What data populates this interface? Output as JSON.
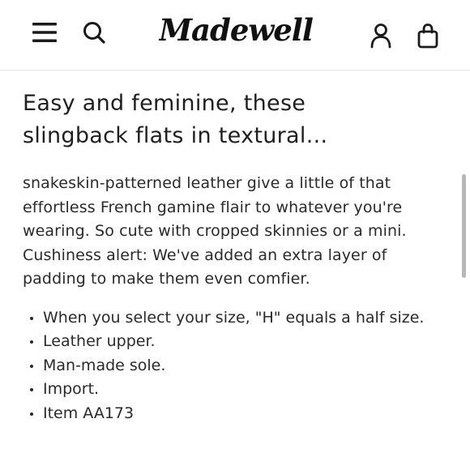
{
  "header": {
    "menu_icon": "hamburger-menu-icon",
    "search_icon": "search-icon",
    "logo_text": "Madewell",
    "account_icon": "account-person-icon",
    "bag_icon": "shopping-bag-icon"
  },
  "product": {
    "title": "Easy and feminine, these slingback flats in textural...",
    "description": "snakeskin-patterned leather give a little of that effortless French gamine flair to whatever you're wearing. So cute with cropped skinnies or a mini. Cushiness alert: We've added an extra layer of padding to make them even comfier.",
    "details": [
      "When you select your size, \"H\" equals a half size.",
      "Leather upper.",
      "Man-made sole.",
      "Import.",
      "Item AA173"
    ]
  },
  "colors": {
    "text": "#1f1f1f",
    "divider": "#e6e6e6",
    "scrollbar": "#b7b7b7"
  }
}
